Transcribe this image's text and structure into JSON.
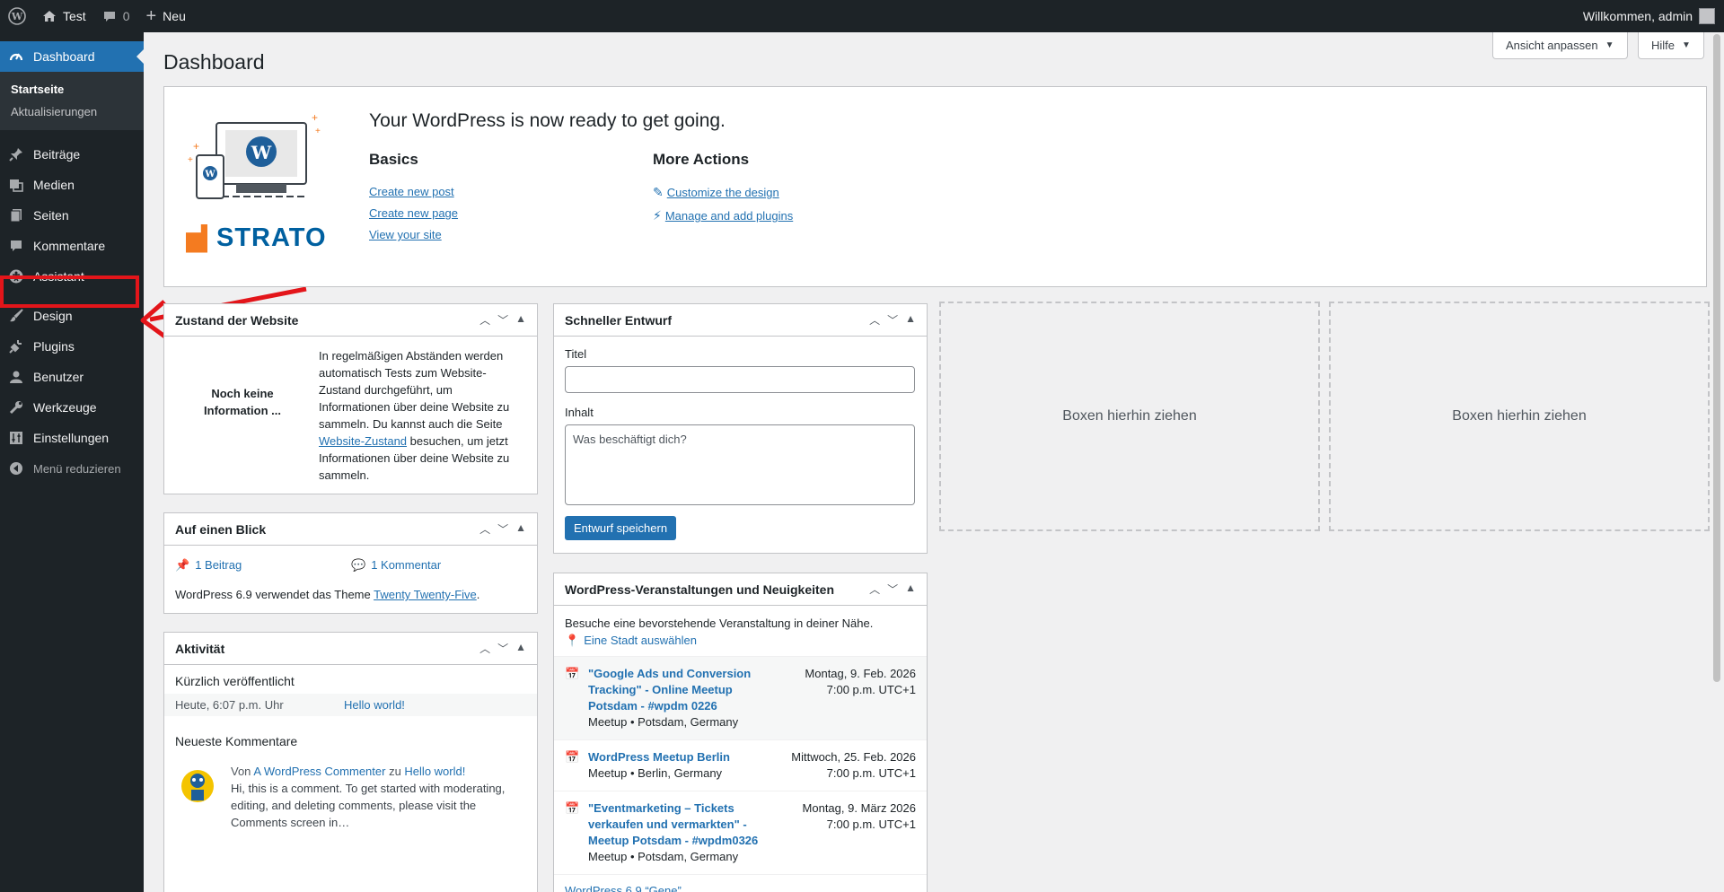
{
  "adminbar": {
    "site_name": "Test",
    "comments_count": "0",
    "new_label": "Neu",
    "welcome": "Willkommen, admin"
  },
  "sidebar": {
    "dashboard": "Dashboard",
    "sub": [
      "Startseite",
      "Aktualisierungen"
    ],
    "items": [
      "Beiträge",
      "Medien",
      "Seiten",
      "Kommentare",
      "Assistant"
    ],
    "items2": [
      "Design",
      "Plugins",
      "Benutzer",
      "Werkzeuge",
      "Einstellungen"
    ],
    "collapse": "Menü reduzieren"
  },
  "screen": {
    "options": "Ansicht anpassen",
    "help": "Hilfe"
  },
  "page": {
    "title": "Dashboard"
  },
  "welcome": {
    "heading": "Your WordPress is now ready to get going.",
    "basics_title": "Basics",
    "basics": [
      "Create new post",
      "Create new page",
      "View your site"
    ],
    "more_title": "More Actions",
    "more": [
      "Customize the design",
      "Manage and add plugins"
    ],
    "logo": "STRATO"
  },
  "site_health": {
    "title": "Zustand der Website",
    "status": "Noch keine Information ...",
    "text1": "In regelmäßigen Abständen werden automatisch Tests zum Website-Zustand durchgeführt, um Informationen über deine Website zu sammeln. Du kannst auch die Seite ",
    "link": "Website-Zustand",
    "text2": " besuchen, um jetzt Informationen über deine Website zu sammeln."
  },
  "at_a_glance": {
    "title": "Auf einen Blick",
    "posts": "1 Beitrag",
    "comments": "1 Kommentar",
    "theme_text": "WordPress 6.9 verwendet das Theme ",
    "theme": "Twenty Twenty-Five"
  },
  "activity": {
    "title": "Aktivität",
    "recent_title": "Kürzlich veröffentlicht",
    "recent_date": "Heute, 6:07 p.m. Uhr",
    "recent_post": "Hello world!",
    "comments_title": "Neueste Kommentare",
    "comment_from": "Von ",
    "comment_author": "A WordPress Commenter",
    "comment_on": " zu ",
    "comment_post": "Hello world!",
    "comment_text": "Hi, this is a comment. To get started with moderating, editing, and deleting comments, please visit the Comments screen in…"
  },
  "quick_draft": {
    "title": "Schneller Entwurf",
    "title_label": "Titel",
    "title_value": "",
    "content_label": "Inhalt",
    "content_placeholder": "Was beschäftigt dich?",
    "save": "Entwurf speichern"
  },
  "events": {
    "title": "WordPress-Veranstaltungen und Neuigkeiten",
    "intro": "Besuche eine bevorstehende Veranstaltung in deiner Nähe.",
    "city_link": "Eine Stadt auswählen",
    "list": [
      {
        "title": "\"Google Ads und Conversion Tracking\" - Online Meetup Potsdam - #wpdm 0226",
        "meta": "Meetup • Potsdam, Germany",
        "date": "Montag, 9. Feb. 2026",
        "time": "7:00 p.m. UTC+1"
      },
      {
        "title": "WordPress Meetup Berlin",
        "meta": "Meetup • Berlin, Germany",
        "date": "Mittwoch, 25. Feb. 2026",
        "time": "7:00 p.m. UTC+1"
      },
      {
        "title": "\"Eventmarketing – Tickets verkaufen und vermarkten\" - Meetup Potsdam - #wpdm0326",
        "meta": "Meetup • Potsdam, Germany",
        "date": "Montag, 9. März 2026",
        "time": "7:00 p.m. UTC+1"
      }
    ],
    "news_partial": "WordPress 6.9 “Gene”"
  },
  "dropzones": [
    "Boxen hierhin ziehen",
    "Boxen hierhin ziehen"
  ],
  "colors": {
    "accent": "#2271b1",
    "adminbar": "#1d2327",
    "highlight": "#e3151a"
  }
}
